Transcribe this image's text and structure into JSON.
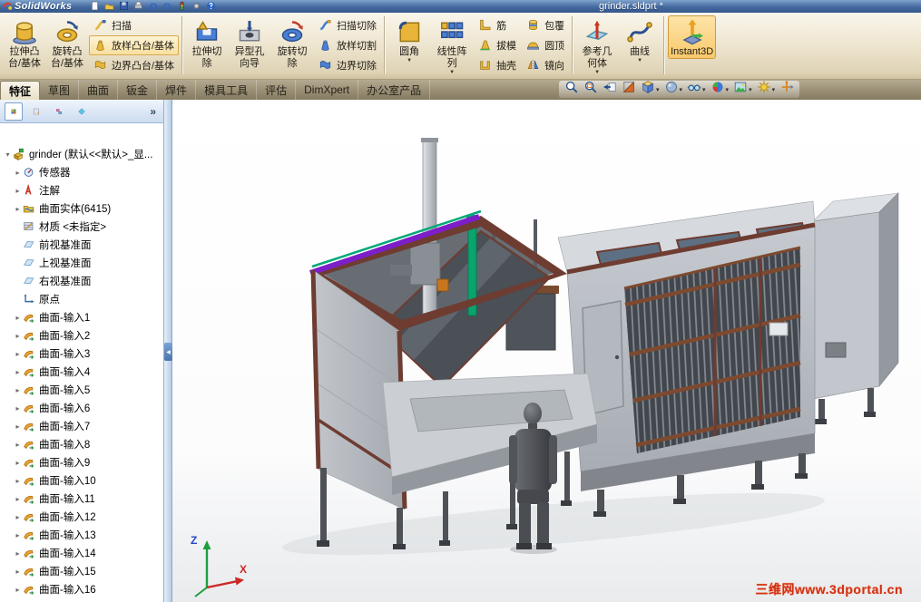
{
  "colors": {
    "titlebar_blue": "#44699e",
    "ribbon_top": "#faf6ec",
    "ribbon_bottom": "#cfc2a0",
    "tabbar_olive": "#978c72",
    "active_tab": "#f0e9d6",
    "selection_amber": "#f9c96b",
    "watermark_red": "#d23018",
    "beam_purple": "#7d1ec8",
    "accent_teal": "#00a878",
    "frame_maroon": "#6e3c30"
  },
  "titlebar": {
    "app_name": "SolidWorks",
    "document_title": "grinder.sldprt *",
    "icons": [
      "new-document-icon",
      "open-icon",
      "save-icon",
      "print-icon",
      "undo-icon",
      "redo-icon",
      "rebuild-icon",
      "options-icon",
      "help-icon"
    ]
  },
  "ribbon": {
    "groups": [
      {
        "items": [
          {
            "type": "big",
            "name": "extruded-boss-base",
            "icon": "extrude",
            "lines": [
              "拉伸凸",
              "台/基体"
            ]
          },
          {
            "type": "big",
            "name": "revolved-boss-base",
            "icon": "revolve",
            "lines": [
              "旋转凸",
              "台/基体"
            ]
          },
          {
            "type": "stack",
            "items": [
              {
                "name": "swept-boss-base",
                "icon": "sweep",
                "label": "扫描"
              },
              {
                "name": "lofted-boss-base",
                "icon": "loft",
                "label": "放样凸台/基体",
                "highlight": true
              },
              {
                "name": "boundary-boss-base",
                "icon": "boundary",
                "label": "边界凸台/基体"
              }
            ]
          }
        ]
      },
      {
        "items": [
          {
            "type": "big",
            "name": "extruded-cut",
            "icon": "extrude-cut",
            "lines": [
              "拉伸切",
              "除"
            ]
          },
          {
            "type": "big",
            "name": "hole-wizard",
            "icon": "hole-wizard",
            "lines": [
              "异型孔",
              "向导"
            ]
          },
          {
            "type": "big",
            "name": "revolved-cut",
            "icon": "revolve-cut",
            "lines": [
              "旋转切",
              "除"
            ]
          },
          {
            "type": "stack",
            "items": [
              {
                "name": "swept-cut",
                "icon": "sweep-cut",
                "label": "扫描切除"
              },
              {
                "name": "lofted-cut",
                "icon": "loft-cut",
                "label": "放样切割"
              },
              {
                "name": "boundary-cut",
                "icon": "boundary-cut",
                "label": "边界切除"
              }
            ]
          }
        ]
      },
      {
        "items": [
          {
            "type": "big",
            "name": "fillet",
            "icon": "fillet",
            "lines": [
              "圆角"
            ],
            "dropdown": true
          },
          {
            "type": "big",
            "name": "linear-pattern",
            "icon": "linear-pattern",
            "lines": [
              "线性阵",
              "列"
            ],
            "dropdown": true
          },
          {
            "type": "stack",
            "items": [
              {
                "name": "rib",
                "icon": "rib",
                "label": "筋"
              },
              {
                "name": "draft",
                "icon": "draft",
                "label": "拔模"
              },
              {
                "name": "shell",
                "icon": "shell",
                "label": "抽壳"
              }
            ]
          },
          {
            "type": "stack",
            "items": [
              {
                "name": "wrap",
                "icon": "wrap",
                "label": "包覆"
              },
              {
                "name": "dome",
                "icon": "dome",
                "label": "圆顶"
              },
              {
                "name": "mirror",
                "icon": "mirror",
                "label": "镜向"
              }
            ]
          }
        ]
      },
      {
        "items": [
          {
            "type": "big",
            "name": "reference-geometry",
            "icon": "ref-geometry",
            "lines": [
              "参考几",
              "何体"
            ],
            "dropdown": true
          },
          {
            "type": "big",
            "name": "curves",
            "icon": "curves",
            "lines": [
              "曲线"
            ],
            "dropdown": true
          }
        ]
      },
      {
        "items": [
          {
            "type": "big",
            "name": "instant3d",
            "icon": "instant3d",
            "lines": [
              "Instant3D"
            ],
            "selected": true
          }
        ]
      }
    ]
  },
  "tabs": [
    {
      "name": "features",
      "label": "特征",
      "active": true
    },
    {
      "name": "sketch",
      "label": "草图"
    },
    {
      "name": "surfaces",
      "label": "曲面"
    },
    {
      "name": "sheet-metal",
      "label": "钣金"
    },
    {
      "name": "weldments",
      "label": "焊件"
    },
    {
      "name": "mold-tools",
      "label": "模具工具"
    },
    {
      "name": "evaluate",
      "label": "评估"
    },
    {
      "name": "dimxpert",
      "label": "DimXpert"
    },
    {
      "name": "office-products",
      "label": "办公室产品"
    }
  ],
  "view_toolbar": [
    {
      "name": "zoom-fit"
    },
    {
      "name": "zoom-area"
    },
    {
      "name": "previous-view"
    },
    {
      "name": "section-view"
    },
    {
      "name": "view-orientation",
      "dropdown": true
    },
    {
      "name": "display-style",
      "dropdown": true
    },
    {
      "name": "hide-show-items",
      "dropdown": true
    },
    {
      "name": "edit-appearance",
      "dropdown": true
    },
    {
      "name": "apply-scene",
      "dropdown": true
    },
    {
      "name": "view-settings",
      "dropdown": true
    },
    {
      "name": "pan-3d"
    }
  ],
  "panel": {
    "tabs": [
      "feature-manager-tab",
      "property-manager-tab",
      "configuration-manager-tab",
      "dimxpert-manager-tab"
    ],
    "overflow_label": "»",
    "tree": [
      {
        "name": "part-root",
        "label": "grinder (默认<<默认>_显...",
        "icon": "part",
        "expand": "open",
        "level": 0
      },
      {
        "name": "sensors",
        "label": "传感器",
        "icon": "sensors",
        "expand": "closed",
        "level": 1
      },
      {
        "name": "annotations",
        "label": "注解",
        "icon": "annotations",
        "expand": "closed",
        "level": 1
      },
      {
        "name": "surface-bodies",
        "label": "曲面实体(6415)",
        "icon": "surface-folder",
        "expand": "closed",
        "level": 1
      },
      {
        "name": "material",
        "label": "材质 <未指定>",
        "icon": "material",
        "expand": "none",
        "level": 1
      },
      {
        "name": "front-plane",
        "label": "前视基准面",
        "icon": "plane",
        "expand": "none",
        "level": 1
      },
      {
        "name": "top-plane",
        "label": "上视基准面",
        "icon": "plane",
        "expand": "none",
        "level": 1
      },
      {
        "name": "right-plane",
        "label": "右视基准面",
        "icon": "plane",
        "expand": "none",
        "level": 1
      },
      {
        "name": "origin",
        "label": "原点",
        "icon": "origin",
        "expand": "none",
        "level": 1
      },
      {
        "name": "imported-surface-1",
        "label": "曲面-输入1",
        "icon": "imported-surface",
        "expand": "closed",
        "level": 1
      },
      {
        "name": "imported-surface-2",
        "label": "曲面-输入2",
        "icon": "imported-surface",
        "expand": "closed",
        "level": 1
      },
      {
        "name": "imported-surface-3",
        "label": "曲面-输入3",
        "icon": "imported-surface",
        "expand": "closed",
        "level": 1
      },
      {
        "name": "imported-surface-4",
        "label": "曲面-输入4",
        "icon": "imported-surface",
        "expand": "closed",
        "level": 1
      },
      {
        "name": "imported-surface-5",
        "label": "曲面-输入5",
        "icon": "imported-surface",
        "expand": "closed",
        "level": 1
      },
      {
        "name": "imported-surface-6",
        "label": "曲面-输入6",
        "icon": "imported-surface",
        "expand": "closed",
        "level": 1
      },
      {
        "name": "imported-surface-7",
        "label": "曲面-输入7",
        "icon": "imported-surface",
        "expand": "closed",
        "level": 1
      },
      {
        "name": "imported-surface-8",
        "label": "曲面-输入8",
        "icon": "imported-surface",
        "expand": "closed",
        "level": 1
      },
      {
        "name": "imported-surface-9",
        "label": "曲面-输入9",
        "icon": "imported-surface",
        "expand": "closed",
        "level": 1
      },
      {
        "name": "imported-surface-10",
        "label": "曲面-输入10",
        "icon": "imported-surface",
        "expand": "closed",
        "level": 1
      },
      {
        "name": "imported-surface-11",
        "label": "曲面-输入11",
        "icon": "imported-surface",
        "expand": "closed",
        "level": 1
      },
      {
        "name": "imported-surface-12",
        "label": "曲面-输入12",
        "icon": "imported-surface",
        "expand": "closed",
        "level": 1
      },
      {
        "name": "imported-surface-13",
        "label": "曲面-输入13",
        "icon": "imported-surface",
        "expand": "closed",
        "level": 1
      },
      {
        "name": "imported-surface-14",
        "label": "曲面-输入14",
        "icon": "imported-surface",
        "expand": "closed",
        "level": 1
      },
      {
        "name": "imported-surface-15",
        "label": "曲面-输入15",
        "icon": "imported-surface",
        "expand": "closed",
        "level": 1
      },
      {
        "name": "imported-surface-16",
        "label": "曲面-输入16",
        "icon": "imported-surface",
        "expand": "closed",
        "level": 1
      }
    ]
  },
  "viewport": {
    "watermark": "三维网www.3dportal.cn",
    "triad": {
      "x": "X",
      "z": "Z"
    }
  }
}
